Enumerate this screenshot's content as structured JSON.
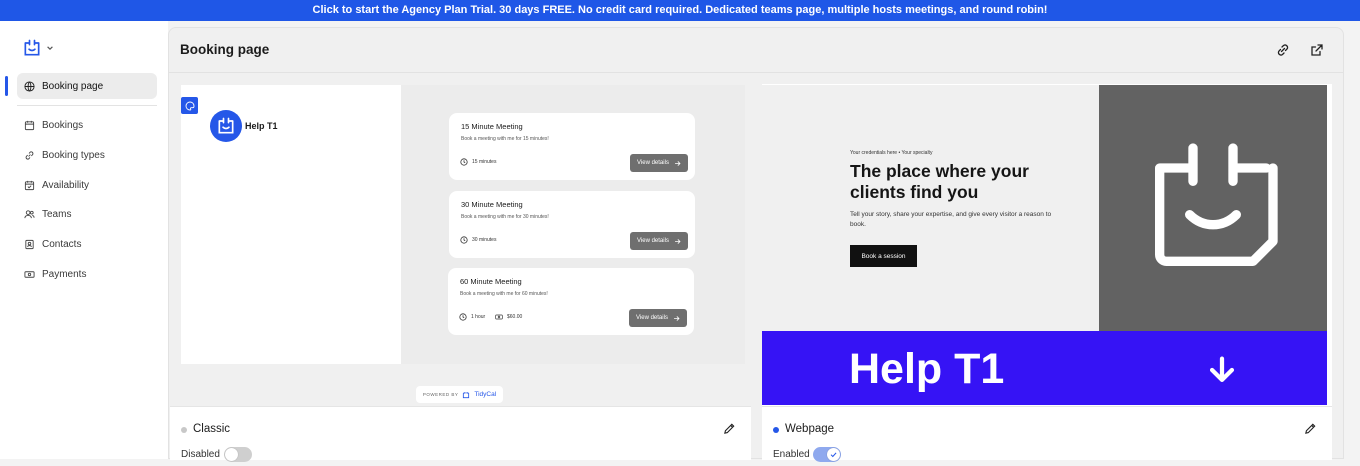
{
  "banner": {
    "text": "Click to start the Agency Plan Trial. 30 days FREE. No credit card required. Dedicated teams page, multiple hosts meetings, and round robin!"
  },
  "sidebar": {
    "items": [
      {
        "label": "Booking page",
        "icon": "globe-icon",
        "active": true
      },
      {
        "label": "Bookings",
        "icon": "calendar-icon"
      },
      {
        "label": "Booking types",
        "icon": "link-icon"
      },
      {
        "label": "Availability",
        "icon": "calendar-check-icon"
      },
      {
        "label": "Teams",
        "icon": "users-icon"
      },
      {
        "label": "Contacts",
        "icon": "contact-card-icon"
      },
      {
        "label": "Payments",
        "icon": "cash-icon"
      }
    ]
  },
  "header": {
    "title": "Booking page"
  },
  "themes": [
    {
      "name": "Classic",
      "status": "Disabled",
      "enabled": false,
      "preview": {
        "host_name": "Help T1",
        "meetings": [
          {
            "title": "15 Minute Meeting",
            "description": "Book a meeting with me for 15 minutes!",
            "duration": "15 minutes",
            "price": "",
            "button": "View details"
          },
          {
            "title": "30 Minute Meeting",
            "description": "Book a meeting with me for 30 minutes!",
            "duration": "30 minutes",
            "price": "",
            "button": "View details"
          },
          {
            "title": "60 Minute Meeting",
            "description": "Book a meeting with me for 60 minutes!",
            "duration": "1 hour",
            "price": "$60.00",
            "button": "View details"
          }
        ],
        "powered_by": "POWERED BY",
        "brand": "TidyCal"
      }
    },
    {
      "name": "Webpage",
      "status": "Enabled",
      "enabled": true,
      "preview": {
        "credentials": "Your credentials here • Your specialty",
        "headline": "The place where your clients find you",
        "subtext": "Tell your story, share your expertise, and give every visitor a reason to book.",
        "cta": "Book a session",
        "band_name": "Help T1"
      }
    }
  ],
  "colors": {
    "accent": "#2557e8",
    "banner": "#1f57e7",
    "band": "#3613f5",
    "disabled_dot": "#c8c8c8"
  }
}
